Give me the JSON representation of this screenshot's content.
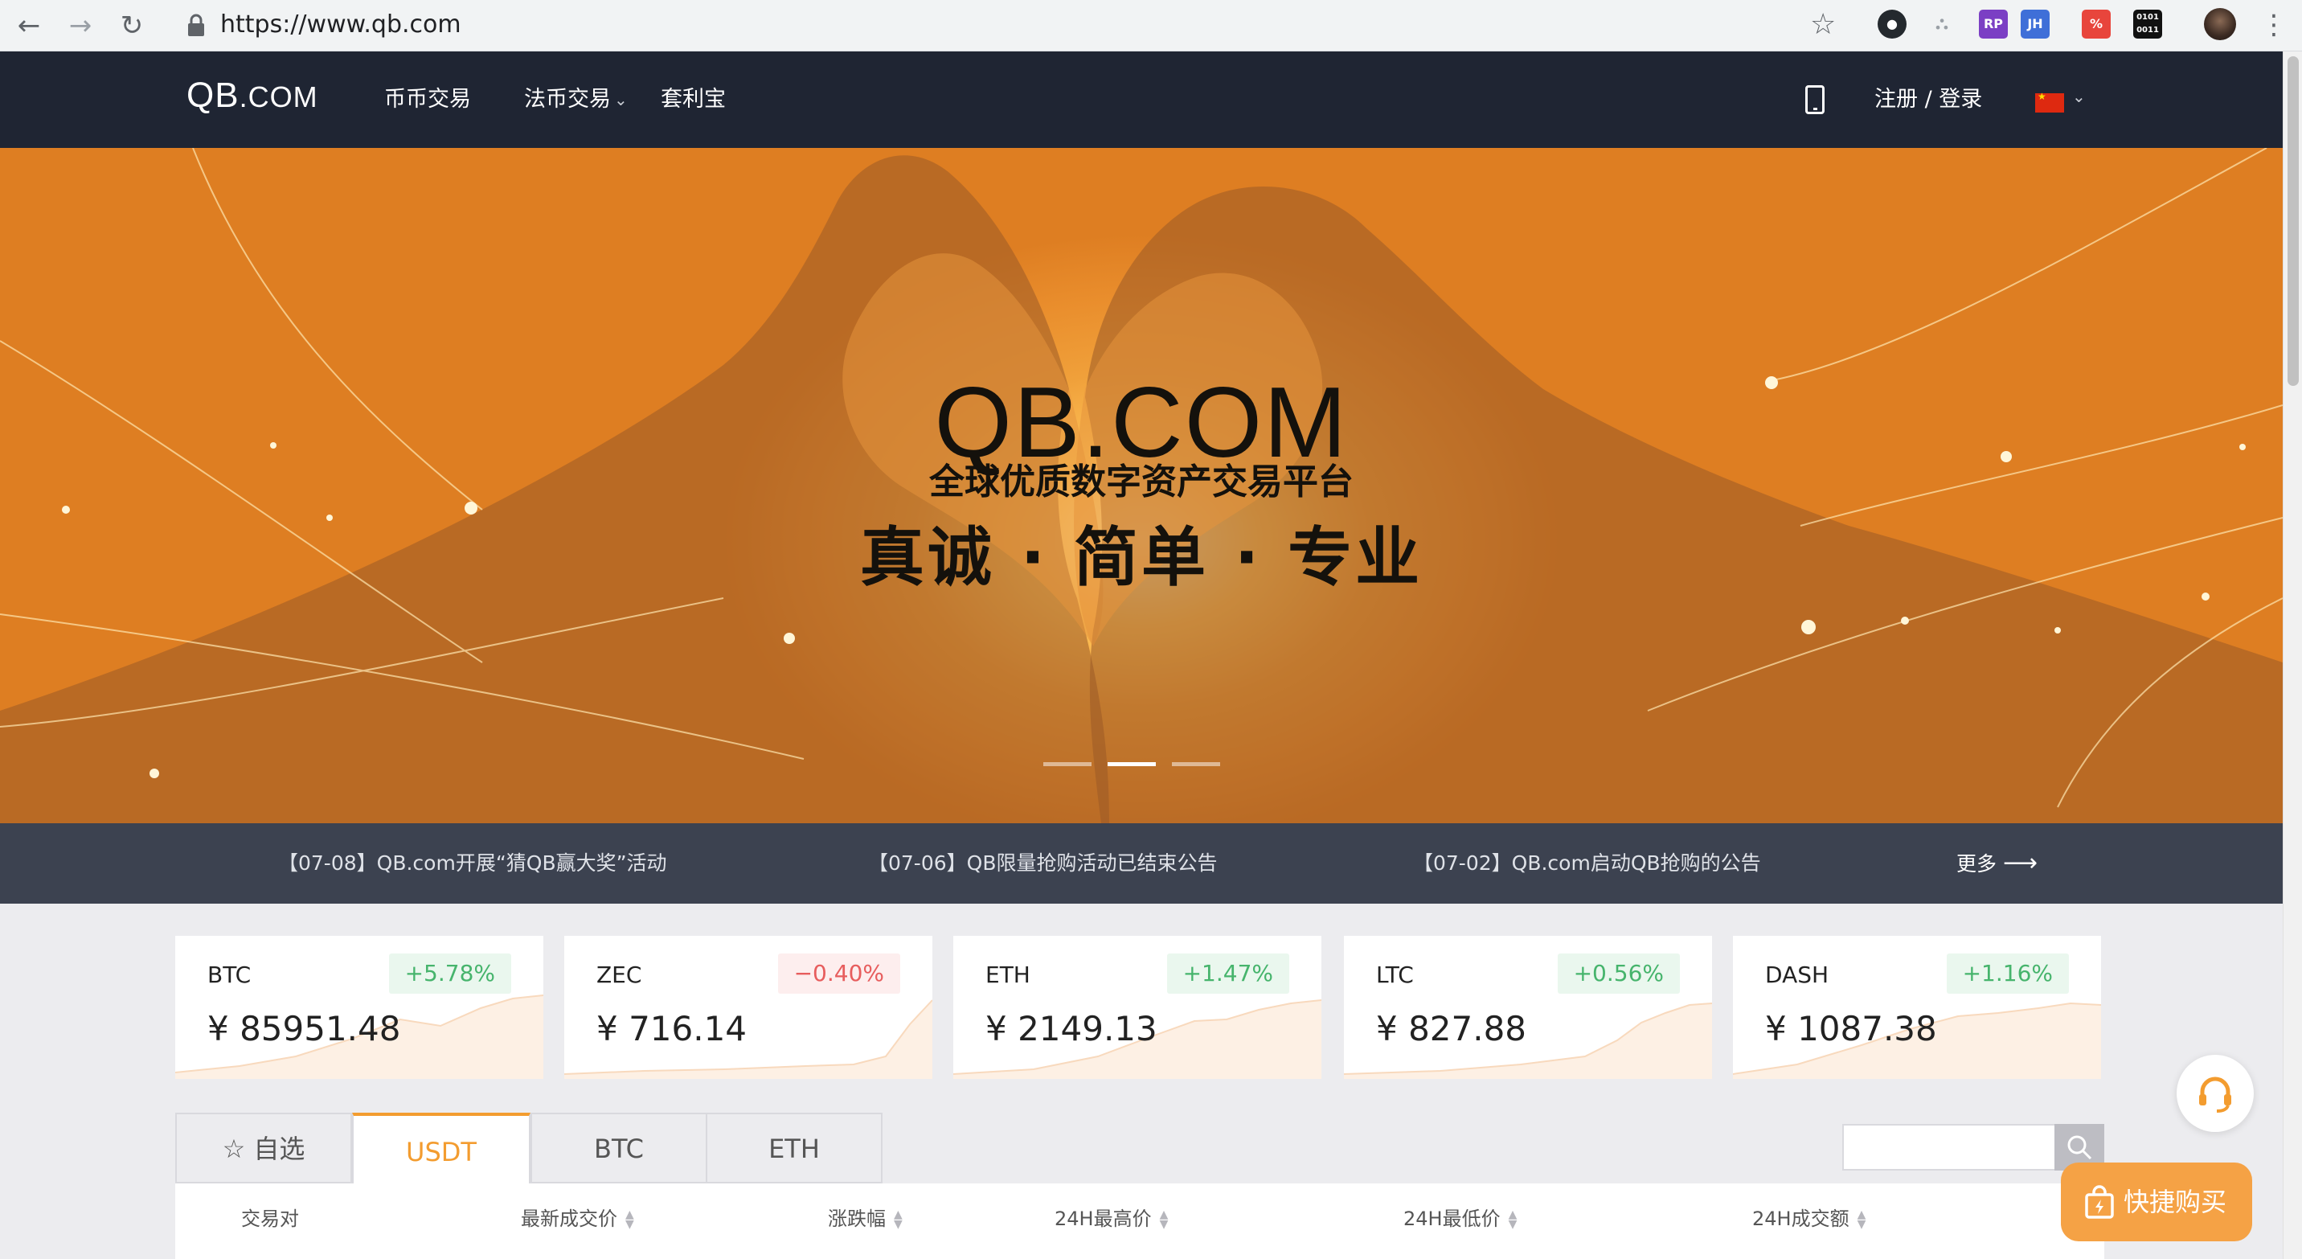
{
  "browser": {
    "url": "https://www.qb.com"
  },
  "header": {
    "logo_main": "QB",
    "logo_suffix": ".COM",
    "nav": [
      "币币交易",
      "法币交易",
      "套利宝"
    ],
    "nav_dropdown_caret": "⌄",
    "auth": "注册 / 登录"
  },
  "banner": {
    "title": "QB.COM",
    "subtitle": "全球优质数字资产交易平台",
    "slogan": "真诚 · 简单 · 专业",
    "slides": 3,
    "active_slide": 2
  },
  "notices": {
    "items": [
      "【07-08】QB.com开展“猜QB赢大奖”活动",
      "【07-06】QB限量抢购活动已结束公告",
      "【07-02】QB.com启动QB抢购的公告"
    ],
    "more": "更多"
  },
  "tickers": [
    {
      "coin": "BTC",
      "change": "+5.78%",
      "direction": "up",
      "price": "¥ 85951.48"
    },
    {
      "coin": "ZEC",
      "change": "−0.40%",
      "direction": "down",
      "price": "¥ 716.14"
    },
    {
      "coin": "ETH",
      "change": "+1.47%",
      "direction": "up",
      "price": "¥ 2149.13"
    },
    {
      "coin": "LTC",
      "change": "+0.56%",
      "direction": "up",
      "price": "¥ 827.88"
    },
    {
      "coin": "DASH",
      "change": "+1.16%",
      "direction": "up",
      "price": "¥ 1087.38"
    }
  ],
  "market_tabs": {
    "favorites": "☆ 自选",
    "tabs": [
      "USDT",
      "BTC",
      "ETH"
    ],
    "active": "USDT"
  },
  "table": {
    "columns": [
      "交易对",
      "最新成交价",
      "涨跌幅",
      "24H最高价",
      "24H最低价",
      "24H成交额"
    ]
  },
  "quick_buy": "快捷购买",
  "colors": {
    "header_bg": "#1f2533",
    "notice_bg": "#3c4250",
    "accent": "#f39c2f",
    "up": "#46b46c",
    "down": "#e75d5d",
    "quick_buy": "#f5a245"
  }
}
